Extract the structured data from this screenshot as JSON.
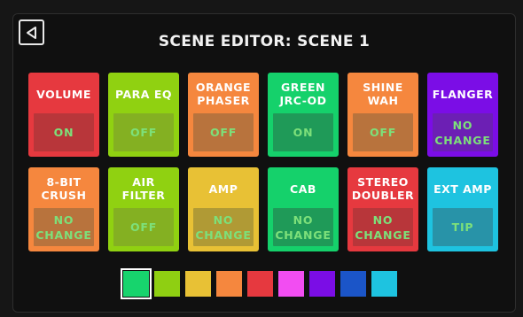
{
  "header": {
    "title": "SCENE EDITOR: SCENE 1",
    "back_icon": "back-triangle-icon"
  },
  "effects": [
    {
      "name": "VOLUME",
      "state": "ON",
      "color": "#e6393f",
      "state_color": "#7de07a",
      "box": "#b8363a"
    },
    {
      "name": "PARA EQ",
      "state": "OFF",
      "color": "#90d111",
      "state_color": "#7de07a",
      "box": "#84b022"
    },
    {
      "name": "ORANGE\nPHASER",
      "state": "OFF",
      "color": "#f5873e",
      "state_color": "#7de07a",
      "box": "#b8733d"
    },
    {
      "name": "GREEN\nJRC-OD",
      "state": "ON",
      "color": "#15d16b",
      "state_color": "#7de07a",
      "box": "#1f9a58"
    },
    {
      "name": "SHINE\nWAH",
      "state": "OFF",
      "color": "#f5873e",
      "state_color": "#7de07a",
      "box": "#b8733d"
    },
    {
      "name": "FLANGER",
      "state": "NO\nCHANGE",
      "color": "#7b0de6",
      "state_color": "#7de07a",
      "box": "#6c1fb4"
    },
    {
      "name": "8-BIT\nCRUSH",
      "state": "NO\nCHANGE",
      "color": "#f5873e",
      "state_color": "#7de07a",
      "box": "#b8733d"
    },
    {
      "name": "AIR\nFILTER",
      "state": "OFF",
      "color": "#90d111",
      "state_color": "#7de07a",
      "box": "#84b022"
    },
    {
      "name": "AMP",
      "state": "NO\nCHANGE",
      "color": "#e8c135",
      "state_color": "#7de07a",
      "box": "#b09a35"
    },
    {
      "name": "CAB",
      "state": "NO\nCHANGE",
      "color": "#15d16b",
      "state_color": "#7de07a",
      "box": "#1f9a58"
    },
    {
      "name": "STEREO\nDOUBLER",
      "state": "NO\nCHANGE",
      "color": "#e6393f",
      "state_color": "#7de07a",
      "box": "#b8363a"
    },
    {
      "name": "EXT AMP",
      "state": "TIP",
      "color": "#1ec3e0",
      "state_color": "#7de07a",
      "box": "#2893a8"
    }
  ],
  "palette": {
    "selected_index": 0,
    "colors": [
      "#17d46d",
      "#8fcf12",
      "#e8c135",
      "#f5873e",
      "#e6393f",
      "#f24df2",
      "#7b0de6",
      "#1b55c8",
      "#1ec3e0"
    ]
  }
}
